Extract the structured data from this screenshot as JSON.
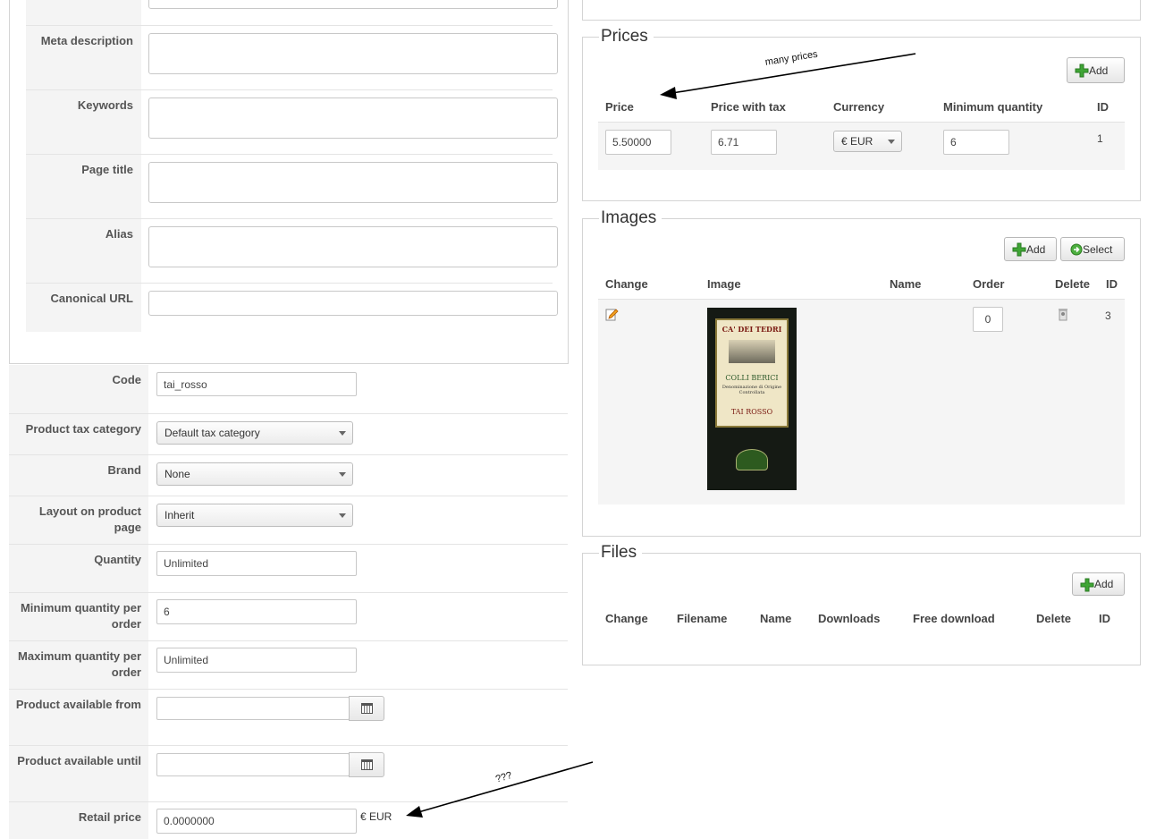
{
  "seo": {
    "labels": {
      "meta_description": "Meta description",
      "keywords": "Keywords",
      "page_title": "Page title",
      "alias": "Alias",
      "canonical_url": "Canonical URL"
    }
  },
  "product_form": {
    "code": {
      "label": "Code",
      "value": "tai_rosso"
    },
    "tax_category": {
      "label": "Product tax category",
      "value": "Default tax category"
    },
    "brand": {
      "label": "Brand",
      "value": "None"
    },
    "layout": {
      "label": "Layout on product page",
      "value": "Inherit"
    },
    "quantity": {
      "label": "Quantity",
      "value": "Unlimited"
    },
    "min_qty": {
      "label": "Minimum quantity per order",
      "value": "6"
    },
    "max_qty": {
      "label": "Maximum quantity per order",
      "value": "Unlimited"
    },
    "available_from": {
      "label": "Product available from",
      "value": ""
    },
    "available_until": {
      "label": "Product available until",
      "value": ""
    },
    "retail_price": {
      "label": "Retail price",
      "value": "0.0000000",
      "currency": "€ EUR"
    }
  },
  "prices": {
    "legend": "Prices",
    "add_label": "Add",
    "columns": [
      "Price",
      "Price with tax",
      "Currency",
      "Minimum quantity",
      "ID"
    ],
    "rows": [
      {
        "price": "5.50000",
        "price_with_tax": "6.71",
        "currency": "€ EUR",
        "min_qty": "6",
        "id": "1"
      }
    ]
  },
  "images": {
    "legend": "Images",
    "add_label": "Add",
    "select_label": "Select",
    "columns": [
      "Change",
      "Image",
      "Name",
      "Order",
      "Delete",
      "ID"
    ],
    "rows": [
      {
        "change_icon": "edit-pencil-icon",
        "order": "0",
        "delete_icon": "trash-icon",
        "id": "3",
        "image_text": {
          "brand": "CA' DEI TEDRI",
          "region": "COLLI BERICI",
          "subtitle": "Denominazione di Origine Controllata",
          "name": "TAI ROSSO"
        }
      }
    ]
  },
  "files": {
    "legend": "Files",
    "add_label": "Add",
    "columns": [
      "Change",
      "Filename",
      "Name",
      "Downloads",
      "Free download",
      "Delete",
      "ID"
    ]
  },
  "annotations": {
    "many_prices": "many prices",
    "question": "???"
  },
  "colors": {
    "add_icon": "#3fa535",
    "select_icon": "#4caf3f",
    "label_bg": "#f4f4f4",
    "border": "#d4d4d4"
  }
}
